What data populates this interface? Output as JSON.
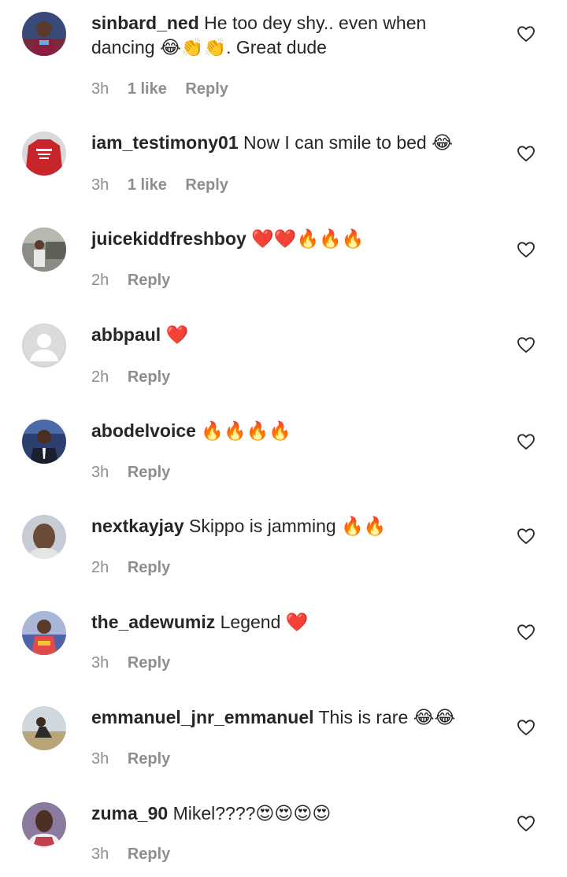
{
  "comments": [
    {
      "username": "sinbard_ned",
      "text": "He too dey shy.. even when dancing 😂👏👏. Great dude",
      "time": "3h",
      "likes": "1 like",
      "reply": "Reply",
      "avatar_icon": "avatar-photo-jersey",
      "avatar_color": "#2b3b6b"
    },
    {
      "username": "iam_testimony01",
      "text": "Now I can smile to bed 😂",
      "time": "3h",
      "likes": "1 like",
      "reply": "Reply",
      "avatar_icon": "avatar-photo-red-jersey",
      "avatar_color": "#c8242b"
    },
    {
      "username": "juicekiddfreshboy",
      "text": "❤️❤️🔥🔥🔥",
      "time": "2h",
      "likes": "",
      "reply": "Reply",
      "avatar_icon": "avatar-photo-person",
      "avatar_color": "#7d7e7a"
    },
    {
      "username": "abbpaul",
      "text": "❤️",
      "time": "2h",
      "likes": "",
      "reply": "Reply",
      "avatar_icon": "default-avatar-icon",
      "avatar_color": "#dbdbdb"
    },
    {
      "username": "abodelvoice",
      "text": "🔥🔥🔥🔥",
      "time": "3h",
      "likes": "",
      "reply": "Reply",
      "avatar_icon": "avatar-photo-suit",
      "avatar_color": "#1f3360"
    },
    {
      "username": "nextkayjay",
      "text": "Skippo is jamming 🔥🔥",
      "time": "2h",
      "likes": "",
      "reply": "Reply",
      "avatar_icon": "avatar-photo-face",
      "avatar_color": "#9aa3b0"
    },
    {
      "username": "the_adewumiz",
      "text": "Legend ❤️",
      "time": "3h",
      "likes": "",
      "reply": "Reply",
      "avatar_icon": "avatar-photo-colorful",
      "avatar_color": "#5a6fb0"
    },
    {
      "username": "emmanuel_jnr_emmanuel",
      "text": "This is rare 😂😂",
      "time": "3h",
      "likes": "",
      "reply": "Reply",
      "avatar_icon": "avatar-photo-outdoor",
      "avatar_color": "#b9b49a"
    },
    {
      "username": "zuma_90",
      "text": "Mikel????😍😍😍😍",
      "time": "3h",
      "likes": "",
      "reply": "Reply",
      "avatar_icon": "avatar-photo-portrait",
      "avatar_color": "#6f5a86"
    }
  ]
}
